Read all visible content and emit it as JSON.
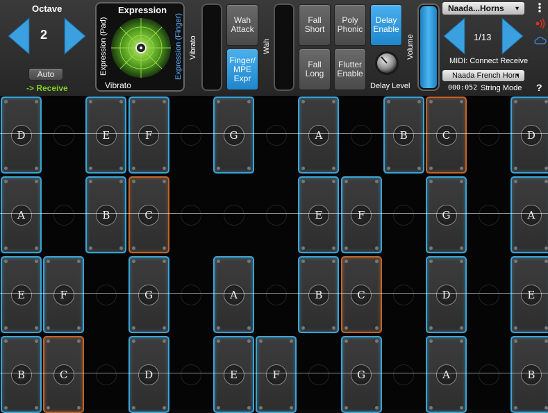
{
  "octave": {
    "title": "Octave",
    "value": "2",
    "auto_label": "Auto",
    "receive_label": "-> Receive"
  },
  "expression": {
    "title": "Expression",
    "left_label": "Expression (Pad)",
    "right_label": "Expression (Finger)",
    "bottom_label": "Vibrato"
  },
  "vibrato_label": "Vibrato",
  "wah_label": "Wah",
  "volume_label": "Volume",
  "buttons": {
    "wah_attack": "Wah Attack",
    "finger_mpe": "Finger/ MPE Expr",
    "fall_short": "Fall Short",
    "poly_phonic": "Poly Phonic",
    "delay_enable": "Delay Enable",
    "fall_long": "Fall Long",
    "flutter_enable": "Flutter Enable",
    "delay_level": "Delay Level"
  },
  "preset": {
    "name": "Naada...Horns",
    "page": "1/13",
    "midi_status": "MIDI: Connect Receive",
    "instrument": "Naada French Horn",
    "counter": "000:052",
    "mode": "String Mode"
  },
  "help_label": "?",
  "colors": {
    "accent": "#3aa4d6",
    "root": "#c0652a",
    "active_button": "#2a96dc",
    "receive_text": "#7fd11c"
  },
  "grid": {
    "rows": [
      [
        "D",
        "",
        "E",
        "F",
        "",
        "G",
        "",
        "A",
        "",
        "B",
        "C",
        "",
        "D"
      ],
      [
        "A",
        "",
        "B",
        "C",
        "",
        "",
        "",
        "E",
        "F",
        "",
        "G",
        "",
        "A"
      ],
      [
        "E",
        "F",
        "",
        "G",
        "",
        "A",
        "",
        "B",
        "C",
        "",
        "D",
        "",
        "E"
      ],
      [
        "B",
        "C",
        "",
        "D",
        "",
        "E",
        "F",
        "",
        "G",
        "",
        "A",
        "",
        "B"
      ]
    ],
    "root_note": "C"
  }
}
